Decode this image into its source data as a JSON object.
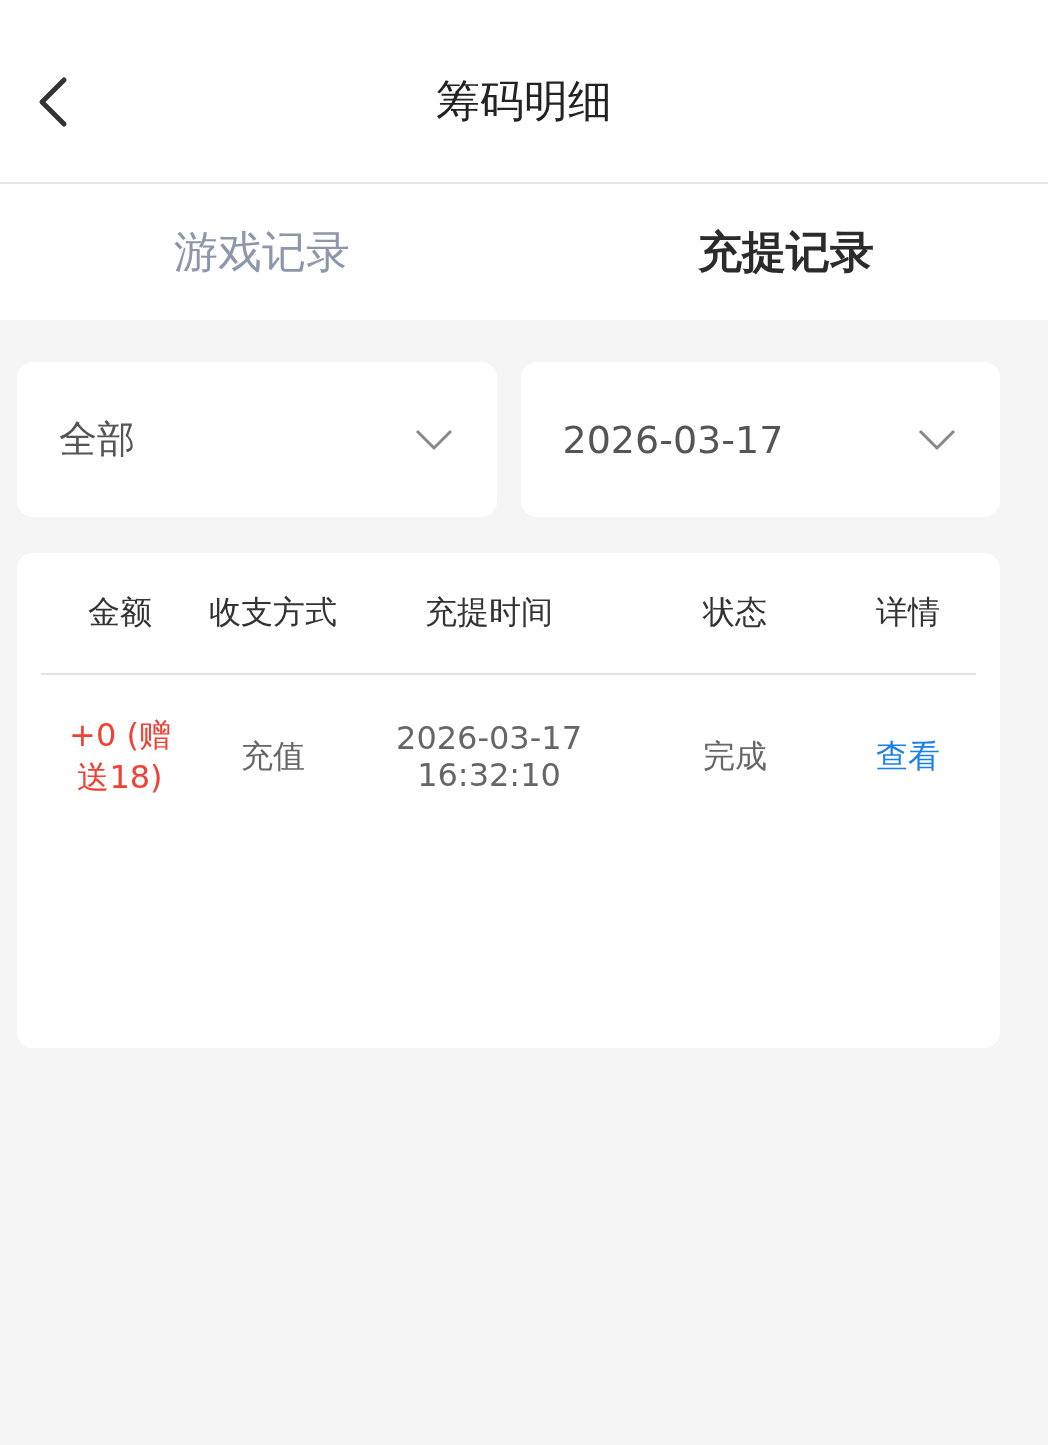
{
  "header": {
    "title": "筹码明细"
  },
  "tabs": [
    {
      "label": "游戏记录",
      "selected": false
    },
    {
      "label": "充提记录",
      "selected": true
    }
  ],
  "filters": [
    {
      "value": "全部"
    },
    {
      "value": "2026-03-17"
    }
  ],
  "table": {
    "columns": [
      "金额",
      "收支方式",
      "充提时间",
      "状态",
      "详情"
    ],
    "rows": [
      {
        "cells": [
          {
            "kind": "amount",
            "text": "+0 (赠送18)"
          },
          {
            "kind": "text",
            "text": "充值"
          },
          {
            "kind": "time",
            "text": "2026-03-17 16:32:10"
          },
          {
            "kind": "text",
            "text": "完成"
          },
          {
            "kind": "link",
            "text": "查看"
          }
        ]
      }
    ]
  }
}
